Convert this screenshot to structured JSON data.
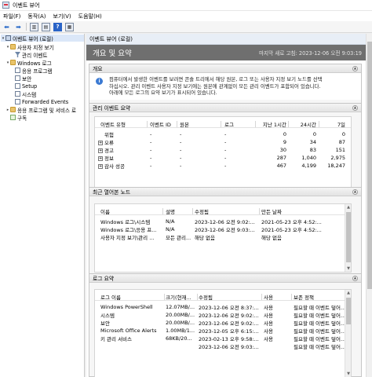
{
  "window": {
    "title": "이벤트 뷰어"
  },
  "menu": [
    "파일(F)",
    "동작(A)",
    "보기(V)",
    "도움말(H)"
  ],
  "toolbar": [
    {
      "name": "back-arrow-icon",
      "glyph": "⬅"
    },
    {
      "name": "forward-arrow-icon",
      "glyph": "➡"
    },
    {
      "name": "console-tree-icon",
      "glyph": ""
    },
    {
      "name": "properties-icon",
      "glyph": ""
    },
    {
      "name": "help-icon",
      "glyph": "?"
    },
    {
      "name": "show-hide-pane-icon",
      "glyph": ""
    }
  ],
  "tree": {
    "root": "이벤트 뷰어 (로컬)",
    "custom_views": "사용자 지정 보기",
    "admin_events": "관리 이벤트",
    "windows_logs": "Windows 로그",
    "application": "응용 프로그램",
    "security": "보안",
    "setup": "Setup",
    "system": "시스템",
    "forwarded": "Forwarded Events",
    "apps_services": "응용 프로그램 및 서비스 로",
    "subscriptions": "구독"
  },
  "content": {
    "header": "이벤트 뷰어 (로컬)",
    "banner_title": "개요 및 요약",
    "last_refreshed": "마지막 새로 고침: 2023-12-06 오전 9:03:19"
  },
  "overview": {
    "title": "개요",
    "lines": [
      "컴퓨터에서 발생한 이벤트를 보려면 콘솔 트리에서 해당 원본, 로그 또는 사용자 지정 보기 노드를 선택",
      "하십시오. 관리 이벤트 사용자 지정 보기에는 원본에 관계없이 모든 관리 이벤트가 포함되어 있습니다.",
      "아래에 모든 로그의 요약 보기가 표시되어 있습니다."
    ]
  },
  "admin_summary": {
    "title": "관리 이벤트 요약",
    "headers": [
      "이벤트 유형",
      "이벤트 ID",
      "원본",
      "로그",
      "지난 1시간",
      "24시간",
      "7일"
    ],
    "rows": [
      {
        "type": "위험",
        "plus": false,
        "id": "-",
        "source": "-",
        "log": "-",
        "h1": "0",
        "h24": "0",
        "d7": "0"
      },
      {
        "type": "오류",
        "plus": true,
        "id": "-",
        "source": "-",
        "log": "-",
        "h1": "9",
        "h24": "34",
        "d7": "87"
      },
      {
        "type": "경고",
        "plus": true,
        "id": "-",
        "source": "-",
        "log": "-",
        "h1": "30",
        "h24": "83",
        "d7": "151"
      },
      {
        "type": "정보",
        "plus": true,
        "id": "-",
        "source": "-",
        "log": "-",
        "h1": "287",
        "h24": "1,040",
        "d7": "2,975"
      },
      {
        "type": "감사 성공",
        "plus": true,
        "id": "-",
        "source": "-",
        "log": "-",
        "h1": "467",
        "h24": "4,199",
        "d7": "18,247"
      }
    ]
  },
  "recent_nodes": {
    "title": "최근 열어본 노드",
    "headers": [
      "이름",
      "설명",
      "수정됨",
      "만든 날짜"
    ],
    "rows": [
      {
        "name": "Windows 로그\\시스템",
        "desc": "N/A",
        "modified": "2023-12-06 오전 9:02:...",
        "created": "2021-05-23 오후 4:52:..."
      },
      {
        "name": "Windows 로그\\응용 프...",
        "desc": "N/A",
        "modified": "2023-12-06 오전 9:03:...",
        "created": "2021-05-23 오후 4:52:..."
      },
      {
        "name": "사용자 지정 보기\\관리 ...",
        "desc": "모든 관리...",
        "modified": "해당 없음",
        "created": "해당 없음"
      }
    ]
  },
  "log_summary": {
    "title": "로그 요약",
    "headers": [
      "로그 이름",
      "크기(현재...",
      "수정됨",
      "사용",
      "보존 정책"
    ],
    "rows": [
      {
        "name": "Windows PowerShell",
        "size": "12.07MB/...",
        "modified": "2023-12-06 오전 8:37:...",
        "enabled": "사용",
        "policy": "필요할 때 이벤트 덮어..."
      },
      {
        "name": "시스템",
        "size": "20.00MB/...",
        "modified": "2023-12-06 오전 9:02:...",
        "enabled": "사용",
        "policy": "필요할 때 이벤트 덮어..."
      },
      {
        "name": "보안",
        "size": "20.00MB/...",
        "modified": "2023-12-06 오전 9:02:...",
        "enabled": "사용",
        "policy": "필요할 때 이벤트 덮어..."
      },
      {
        "name": "Microsoft Office Alerts",
        "size": "1.00MB/1...",
        "modified": "2023-12-05 오후 6:15:...",
        "enabled": "사용",
        "policy": "필요할 때 이벤트 덮어..."
      },
      {
        "name": "키 관리 서비스",
        "size": "68KB/20...",
        "modified": "2023-02-13 오후 9:58:...",
        "enabled": "사용",
        "policy": "필요할 때 이벤트 덮어..."
      },
      {
        "name": "",
        "size": "",
        "modified": "2023-12-06 오전 9:03:...",
        "enabled": "",
        "policy": "필요할 때 이벤트 덮어..."
      }
    ]
  }
}
